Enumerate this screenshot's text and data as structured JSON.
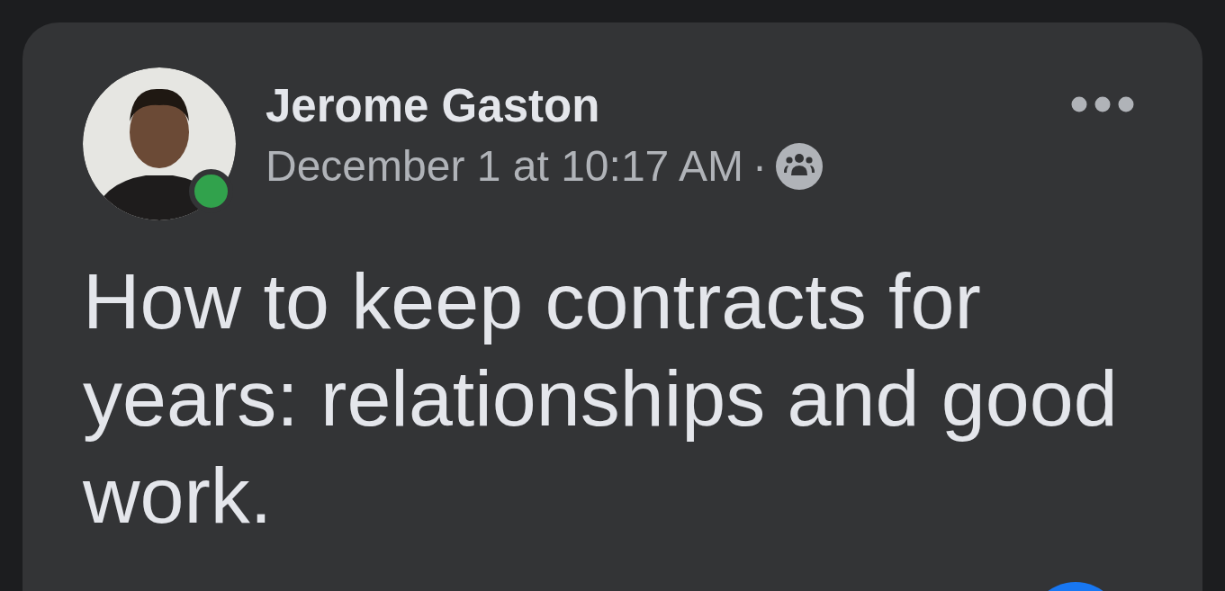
{
  "post": {
    "author": {
      "name": "Jerome Gaston",
      "online": true
    },
    "timestamp": "December 1 at 10:17 AM",
    "separator": "·",
    "text": "How to keep contracts for years: relationships and good work."
  }
}
